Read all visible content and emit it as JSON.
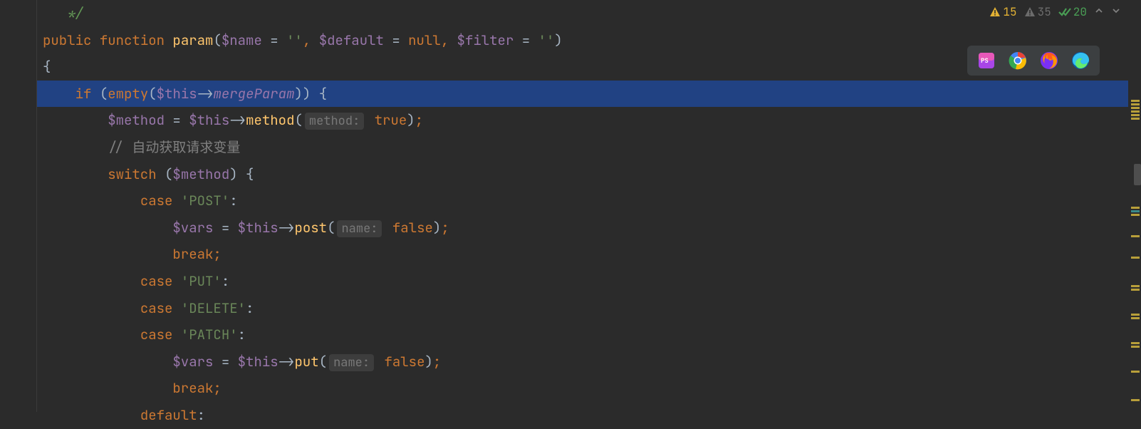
{
  "status": {
    "warn_yellow": "15",
    "warn_gray": "35",
    "check_green": "20"
  },
  "code": {
    "kw_public": "public",
    "kw_function": "function",
    "kw_if": "if",
    "kw_switch": "switch",
    "kw_case": "case",
    "kw_break": "break",
    "kw_default": "default",
    "kw_null": "null",
    "kw_true": "true",
    "kw_false": "false",
    "kw_empty": "empty",
    "fn_param": "param",
    "var_name": "$name",
    "var_default": "$default",
    "var_filter": "$filter",
    "var_this": "$this",
    "var_method": "$method",
    "var_vars": "$vars",
    "prop_mergeParam": "mergeParam",
    "method_method": "method",
    "method_post": "post",
    "method_put": "put",
    "str_empty": "''",
    "str_post": "'POST'",
    "str_put": "'PUT'",
    "str_delete": "'DELETE'",
    "str_patch": "'PATCH'",
    "hint_method": "method:",
    "hint_name": "name:",
    "comment_auto": "// 自动获取请求变量",
    "comment_star": "*/",
    "colon": ":",
    "semi": ";"
  },
  "browsers": [
    "phpstorm",
    "chrome",
    "firefox",
    "edge"
  ]
}
